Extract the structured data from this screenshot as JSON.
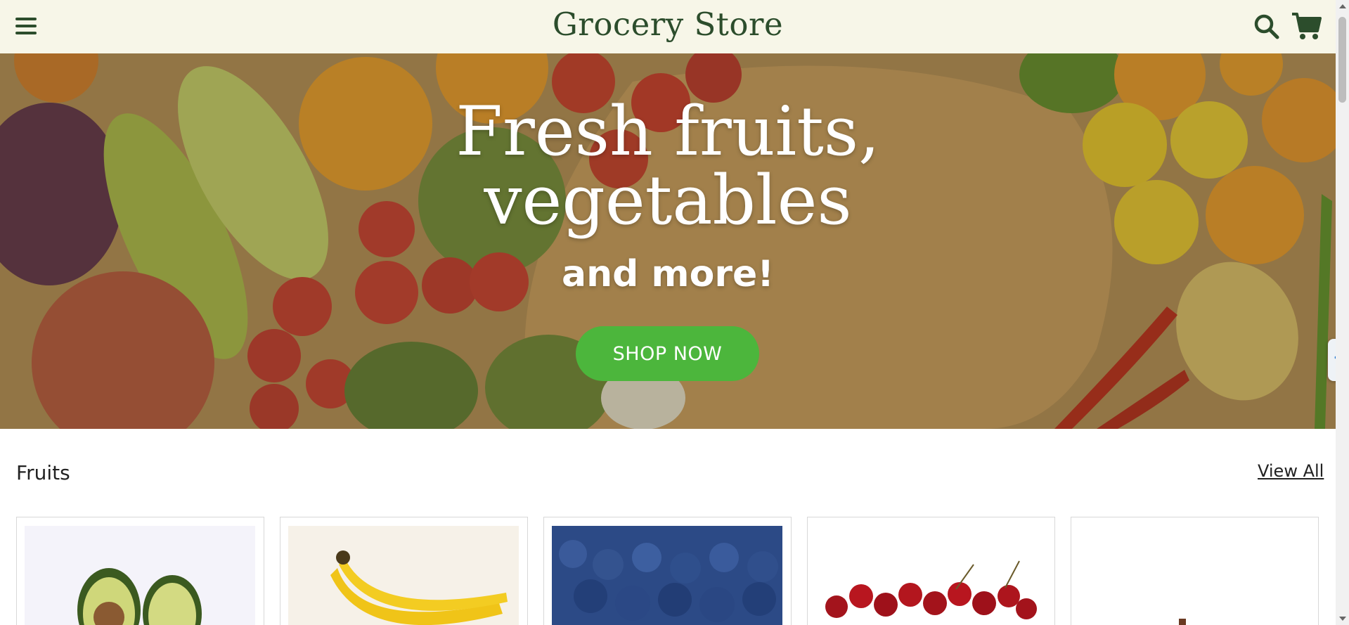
{
  "header": {
    "brand": "Grocery Store",
    "icons": {
      "menu": "menu-icon",
      "search": "search-icon",
      "cart": "cart-icon"
    }
  },
  "hero": {
    "title_line1": "Fresh fruits,",
    "title_line2": "vegetables",
    "subtitle": "and more!",
    "cta_label": "SHOP NOW"
  },
  "section": {
    "title": "Fruits",
    "view_all": "View All",
    "cards": [
      {
        "image": "avocado"
      },
      {
        "image": "banana"
      },
      {
        "image": "blueberry"
      },
      {
        "image": "cherry"
      },
      {
        "image": "fruit"
      }
    ]
  },
  "colors": {
    "header_bg": "#f7f6e8",
    "brand": "#2c4d2c",
    "cta": "#4cb63c"
  }
}
